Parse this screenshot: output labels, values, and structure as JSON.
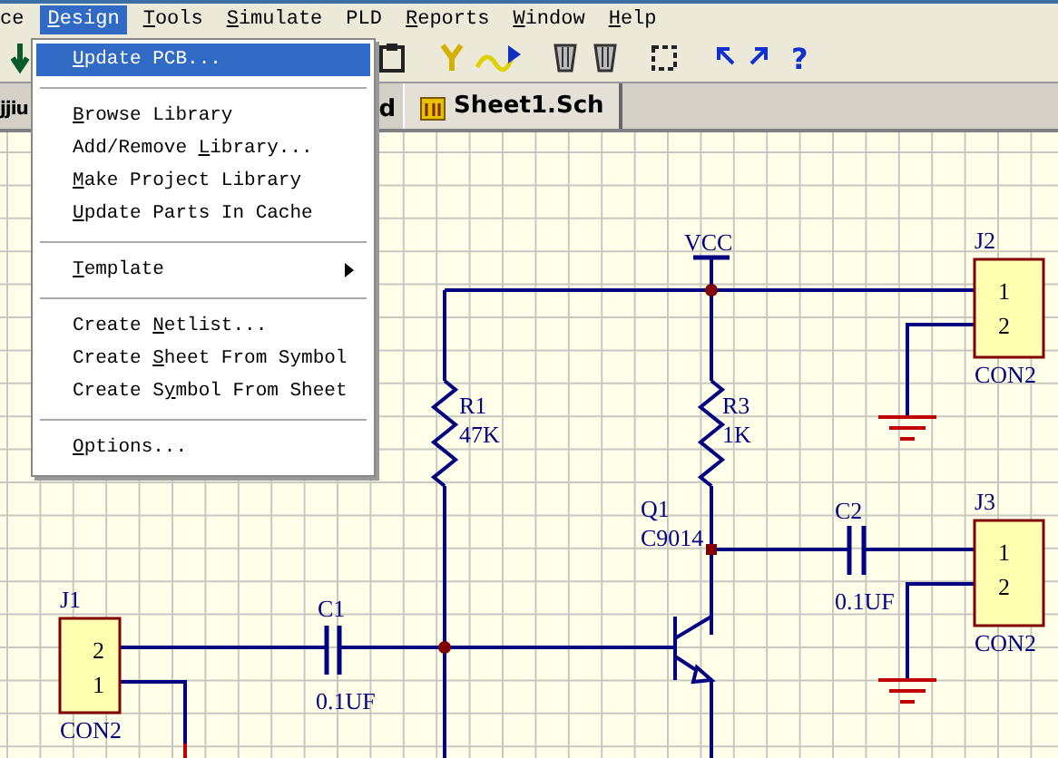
{
  "menubar": [
    {
      "post": "ce",
      "selected": false
    },
    {
      "key": "D",
      "post": "esign",
      "selected": true
    },
    {
      "key": "T",
      "post": "ools",
      "selected": false
    },
    {
      "key": "S",
      "post": "imulate",
      "selected": false
    },
    {
      "post": "PLD",
      "selected": false
    },
    {
      "key": "R",
      "post": "eports",
      "selected": false
    },
    {
      "key": "W",
      "post": "indow",
      "selected": false
    },
    {
      "key": "H",
      "post": "elp",
      "selected": false
    }
  ],
  "toolbar": [
    {
      "kind": "arrow-down"
    },
    {
      "kind": "clipboard"
    },
    {
      "kind": "probe"
    },
    {
      "kind": "wave"
    },
    {
      "kind": "mug"
    },
    {
      "kind": "mug"
    },
    {
      "kind": "select-box"
    },
    {
      "kind": "undo"
    },
    {
      "kind": "redo"
    },
    {
      "kind": "help",
      "glyph": "?"
    }
  ],
  "tabs": [
    {
      "label": "jjiu",
      "selected": false
    },
    {
      "label": "d",
      "selected": false
    },
    {
      "label": "Sheet1.Sch",
      "selected": true
    }
  ],
  "menu": [
    {
      "kind": "item",
      "key": "U",
      "post": "pdate PCB...",
      "selected": true
    },
    {
      "kind": "separator"
    },
    {
      "kind": "item",
      "key": "B",
      "post": "rowse Library",
      "selected": false
    },
    {
      "kind": "item",
      "pre": "Add/Remove ",
      "key": "L",
      "post": "ibrary...",
      "selected": false
    },
    {
      "kind": "item",
      "key": "M",
      "post": "ake Project Library",
      "selected": false
    },
    {
      "kind": "item",
      "key": "U",
      "post": "pdate Parts In Cache",
      "selected": false
    },
    {
      "kind": "separator"
    },
    {
      "kind": "submenu",
      "key": "T",
      "post": "emplate",
      "selected": false
    },
    {
      "kind": "separator"
    },
    {
      "kind": "item",
      "pre": "Create ",
      "key": "N",
      "post": "etlist...",
      "selected": false
    },
    {
      "kind": "item",
      "pre": "Create ",
      "key": "S",
      "post": "heet From Symbol",
      "selected": false
    },
    {
      "kind": "item",
      "pre": "Create S",
      "key": "y",
      "post": "mbol From Sheet",
      "selected": false
    },
    {
      "kind": "separator"
    },
    {
      "kind": "item",
      "key": "O",
      "post": "ptions...",
      "selected": false
    }
  ],
  "schematic": {
    "power": "VCC",
    "parts": [
      {
        "ref": "R1",
        "value": "47K"
      },
      {
        "ref": "R3",
        "value": "1K"
      },
      {
        "ref": "Q1",
        "value": "C9014"
      },
      {
        "ref": "C1",
        "value": "0.1UF"
      },
      {
        "ref": "C2",
        "value": "0.1UF"
      }
    ],
    "connectors": [
      {
        "ref": "J2",
        "part": "CON2",
        "pins": [
          "1",
          "2"
        ]
      },
      {
        "ref": "J3",
        "part": "CON2",
        "pins": [
          "1",
          "2"
        ]
      },
      {
        "ref": "J1",
        "part": "CON2",
        "pins": [
          "2",
          "1"
        ]
      }
    ]
  }
}
